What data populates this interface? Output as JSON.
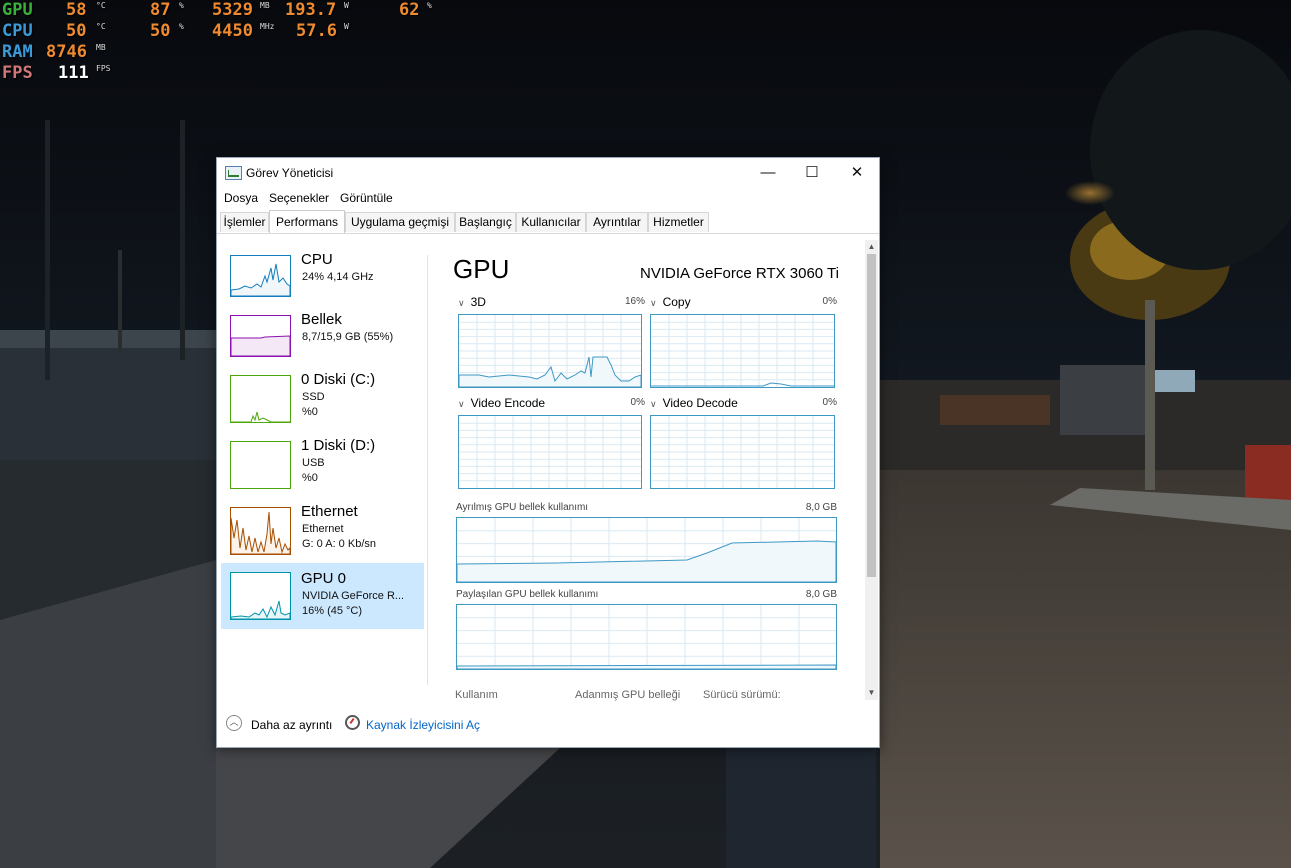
{
  "osd": {
    "rows": [
      {
        "label": "GPU",
        "label_color": "#3ab03a",
        "v1": "58",
        "u1": "°C",
        "v2": "87",
        "u2": "%",
        "v3": "5329",
        "u3": "MB",
        "v4": "193.7",
        "u4": "W",
        "v5": "62",
        "u5": "%"
      },
      {
        "label": "CPU",
        "label_color": "#3a9ad8",
        "v1": "50",
        "u1": "°C",
        "v2": "50",
        "u2": "%",
        "v3": "4450",
        "u3": "MHz",
        "v4": "57.6",
        "u4": "W"
      },
      {
        "label": "RAM",
        "label_color": "#3a9ad8",
        "v1": "8746",
        "u1": "MB"
      },
      {
        "label": "FPS",
        "label_color": "#d07878",
        "v1": "111",
        "u1": "FPS"
      }
    ]
  },
  "window": {
    "title": "Görev Yöneticisi",
    "controls": {
      "minimize": "—",
      "maximize": "☐",
      "close": "✕"
    },
    "menu": [
      "Dosya",
      "Seçenekler",
      "Görüntüle"
    ],
    "tabs": [
      "İşlemler",
      "Performans",
      "Uygulama geçmişi",
      "Başlangıç",
      "Kullanıcılar",
      "Ayrıntılar",
      "Hizmetler"
    ],
    "active_tab": "Performans"
  },
  "sidebar": {
    "items": [
      {
        "title": "CPU",
        "line1": "24% 4,14 GHz",
        "line2": "",
        "color": "#117dbb",
        "fill": "#f1f6fa"
      },
      {
        "title": "Bellek",
        "line1": "8,7/15,9 GB (55%)",
        "line2": "",
        "color": "#8b12ae",
        "fill": "#f4e8f7"
      },
      {
        "title": "0 Diski (C:)",
        "line1": "SSD",
        "line2": "%0",
        "color": "#4da60c",
        "fill": "#eff7e9"
      },
      {
        "title": "1 Diski (D:)",
        "line1": "USB",
        "line2": "%0",
        "color": "#4da60c",
        "fill": "#eff7e9"
      },
      {
        "title": "Ethernet",
        "line1": "Ethernet",
        "line2": "G: 0 A: 0 Kb/sn",
        "color": "#a74f01",
        "fill": "#fcf3eb"
      },
      {
        "title": "GPU 0",
        "line1": "NVIDIA GeForce R...",
        "line2": "16% (45 °C)",
        "color": "#0094aa",
        "fill": "#e8f6f8"
      }
    ],
    "selected": "GPU 0"
  },
  "main": {
    "title": "GPU",
    "device_name": "NVIDIA GeForce RTX 3060 Ti",
    "engines": [
      {
        "name": "3D",
        "percent": "16%"
      },
      {
        "name": "Copy",
        "percent": "0%"
      },
      {
        "name": "Video Encode",
        "percent": "0%"
      },
      {
        "name": "Video Decode",
        "percent": "0%"
      }
    ],
    "dedicated_label": "Ayrılmış GPU bellek kullanımı",
    "dedicated_max": "8,0 GB",
    "shared_label": "Paylaşılan GPU bellek kullanımı",
    "shared_max": "8,0 GB",
    "stats": [
      "Kullanım",
      "Adanmış GPU belleği",
      "Sürücü sürümü:"
    ]
  },
  "footer": {
    "less_details": "Daha az ayrıntı",
    "resource_monitor": "Kaynak İzleyicisini Aç"
  },
  "colors": {
    "gpu_line": "#3e98c4",
    "grid": "#d9eaf4",
    "selection": "#cce8ff",
    "link": "#0066cc"
  }
}
